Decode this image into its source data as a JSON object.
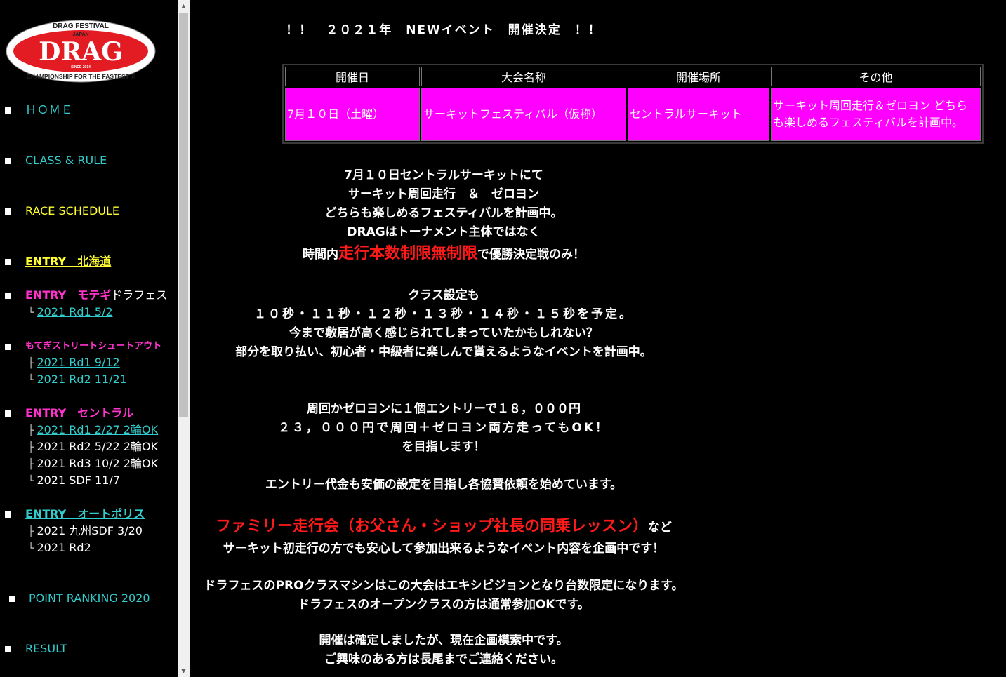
{
  "logo": {
    "top_text": "DRAG FESTIVAL",
    "sub_text": "JAPAN",
    "main_text": "DRAG",
    "since_text": "SINCE 2014",
    "bottom_text": "CHAMPIONSHIP FOR THE FASTEST ®",
    "colors": {
      "red": "#e31b23",
      "white": "#ffffff"
    }
  },
  "sidebar": {
    "items": [
      {
        "label": "ＨＯＭＥ"
      },
      {
        "label": "CLASS & RULE"
      },
      {
        "label": "RACE SCHEDULE"
      },
      {
        "label": "ENTRY　北海道"
      },
      {
        "label": "ENTRY　モテギ",
        "suffix": "ドラフェス",
        "subs": [
          {
            "tree": "└",
            "label": "2021 Rd1 5/2"
          }
        ]
      },
      {
        "label": "もてぎストリートシュートアウト",
        "subs": [
          {
            "tree": "├",
            "label": "2021 Rd1 9/12"
          },
          {
            "tree": "└",
            "label": "2021 Rd2 11/21"
          }
        ]
      },
      {
        "label": "ENTRY　セントラル",
        "subs": [
          {
            "tree": "├",
            "label": "2021 Rd1 2/27 2輪OK"
          },
          {
            "tree": "├",
            "label": "2021 Rd2 5/22 2輪OK"
          },
          {
            "tree": "├",
            "label": "2021 Rd3 10/2 2輪OK"
          },
          {
            "tree": "└",
            "label": "2021 SDF 11/7"
          }
        ]
      },
      {
        "label": "ENTRY　オートポリス",
        "subs": [
          {
            "tree": "├",
            "label": "2021 九州SDF 3/20"
          },
          {
            "tree": "└",
            "label": "2021 Rd2"
          }
        ]
      },
      {
        "label": "POINT RANKING 2020"
      },
      {
        "label": "RESULT"
      }
    ]
  },
  "main": {
    "headline": "！！　２０２１年　NEWイベント　開催決定　！！",
    "table": {
      "headers": [
        "開催日",
        "大会名称",
        "開催場所",
        "その他"
      ],
      "row": [
        "7月１０日（土曜）",
        "サーキットフェスティバル（仮称）",
        "セントラルサーキット",
        "サーキット周回走行＆ゼロヨン どちらも楽しめるフェスティバルを計画中。"
      ]
    },
    "para1": {
      "line1": "7月１０日セントラルサーキットにて",
      "line2": "サーキット周回走行　＆　ゼロヨン",
      "line3": "どちらも楽しめるフェスティバルを計画中。",
      "line4": "DRAGはトーナメント主体ではなく",
      "line5_pre": "時間内",
      "line5_red": "走行本数制限無制限",
      "line5_post": "で優勝決定戦のみ！"
    },
    "para2": {
      "line1": "クラス設定も",
      "line2": "１０秒・１１秒・１２秒・１３秒・１４秒・１５秒を予定。",
      "line3": "今まで敷居が高く感じられてしまっていたかもしれない？",
      "line4": "部分を取り払い、初心者・中級者に楽しんで貰えるようなイベントを計画中。"
    },
    "para3": {
      "line1": "周回かゼロヨンに１個エントリーで１８，０００円",
      "line2": "２３，０００円で周回＋ゼロヨン両方走ってもOK！",
      "line3": "を目指します！"
    },
    "para4": "エントリー代金も安価の設定を目指し各協賛依頼を始めています。",
    "para5": {
      "red": "ファミリー走行会（お父さん・ショップ社長の同乗レッスン）",
      "post": "など",
      "line2": "サーキット初走行の方でも安心して参加出来るようなイベント内容を企画中です！"
    },
    "para6": {
      "line1": "ドラフェスのPROクラスマシンはこの大会はエキシビジョンとなり台数限定になります。",
      "line2": "ドラフェスのオープンクラスの方は通常参加OKです。"
    },
    "para7": {
      "line1": "開催は確定しましたが、現在企画模索中です。",
      "line2": "ご興味のある方は長尾までご連絡ください。"
    }
  },
  "colors": {
    "background": "#000000",
    "nav_cyan": "#33cccc",
    "nav_yellow": "#ffff33",
    "nav_magenta": "#ff33cc",
    "table_cell": "#ff00ff",
    "highlight_red": "#ff1a1a"
  }
}
